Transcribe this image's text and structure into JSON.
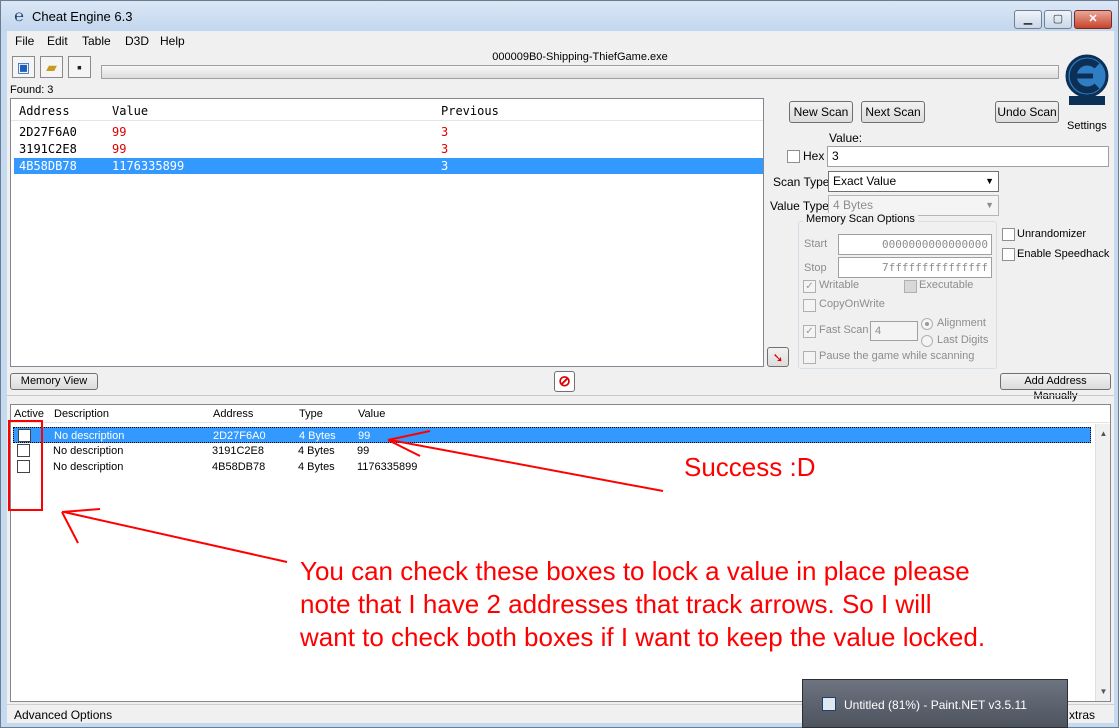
{
  "window": {
    "title": "Cheat Engine 6.3",
    "process": "000009B0-Shipping-ThiefGame.exe",
    "found": "Found: 3"
  },
  "menu": [
    "File",
    "Edit",
    "Table",
    "D3D",
    "Help"
  ],
  "toolbar": {
    "open_process_icon": "computer-icon",
    "open_file_icon": "folder-icon",
    "save_icon": "floppy-disk-icon"
  },
  "settings_label": "Settings",
  "results": {
    "headers": {
      "address": "Address",
      "value": "Value",
      "previous": "Previous"
    },
    "rows": [
      {
        "address": "2D27F6A0",
        "value": "99",
        "previous": "3"
      },
      {
        "address": "3191C2E8",
        "value": "99",
        "previous": "3"
      },
      {
        "address": "4B58DB78",
        "value": "1176335899",
        "previous": "3",
        "selected": true
      }
    ]
  },
  "scan": {
    "new_scan": "New Scan",
    "next_scan": "Next Scan",
    "undo_scan": "Undo Scan",
    "value_label": "Value:",
    "hex_label": "Hex",
    "value": "3",
    "scan_type_label": "Scan Type",
    "scan_type": "Exact Value",
    "value_type_label": "Value Type",
    "value_type": "4 Bytes",
    "memory_scan_options": "Memory Scan Options",
    "start_label": "Start",
    "start_value": "0000000000000000",
    "stop_label": "Stop",
    "stop_value": "7fffffffffffffff",
    "writable": "Writable",
    "executable": "Executable",
    "copy_on_write": "CopyOnWrite",
    "fast_scan": "Fast Scan",
    "fast_scan_value": "4",
    "alignment": "Alignment",
    "last_digits": "Last Digits",
    "pause": "Pause the game while scanning",
    "unrandomizer": "Unrandomizer",
    "enable_speedhack": "Enable Speedhack"
  },
  "buttons": {
    "memory_view": "Memory View",
    "add_address_manually": "Add Address Manually"
  },
  "address_list": {
    "headers": {
      "active": "Active",
      "description": "Description",
      "address": "Address",
      "type": "Type",
      "value": "Value"
    },
    "rows": [
      {
        "description": "No description",
        "address": "2D27F6A0",
        "type": "4 Bytes",
        "value": "99",
        "selected": true
      },
      {
        "description": "No description",
        "address": "3191C2E8",
        "type": "4 Bytes",
        "value": "99"
      },
      {
        "description": "No description",
        "address": "4B58DB78",
        "type": "4 Bytes",
        "value": "1176335899"
      }
    ]
  },
  "status": {
    "advanced_options": "Advanced Options",
    "extras": "xtras"
  },
  "taskbar": {
    "label": "Untitled (81%) - Paint.NET v3.5.11"
  },
  "annotations": {
    "success": "Success :D",
    "note_lines": [
      "You can check these boxes to lock a value in place please",
      "note that I have 2 addresses that track arrows. So I will",
      "want to check both boxes if I want to keep the value locked."
    ],
    "color": "#ff0000"
  },
  "colors": {
    "selection": "#3399ff",
    "value_red": "#e00000"
  }
}
